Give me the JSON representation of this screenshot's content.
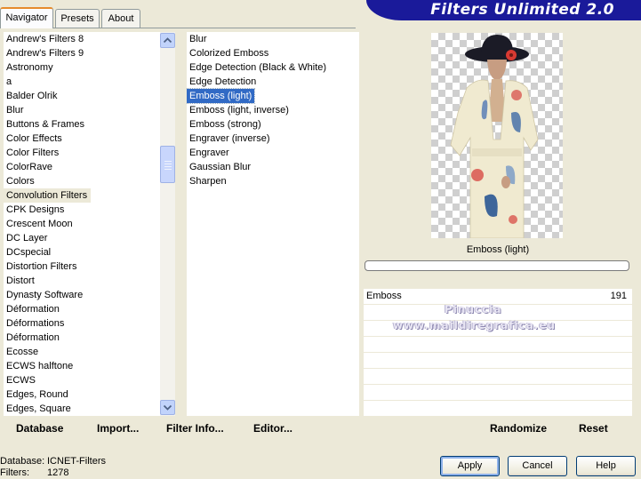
{
  "tabs": [
    {
      "label": "Navigator",
      "active": true
    },
    {
      "label": "Presets",
      "active": false
    },
    {
      "label": "About",
      "active": false
    }
  ],
  "app_title": "Filters Unlimited 2.0",
  "categories": [
    "Andrew's Filters 8",
    "Andrew's Filters 9",
    "Astronomy",
    "a",
    "Balder Olrik",
    "Blur",
    "Buttons & Frames",
    "Color Effects",
    "Color Filters",
    "ColorRave",
    "Colors",
    "Convolution Filters",
    "CPK Designs",
    "Crescent Moon",
    "DC Layer",
    "DCspecial",
    "Distortion Filters",
    "Distort",
    "Dynasty Software",
    "Déformation",
    "Déformations",
    "Déformation",
    "Ecosse",
    "ECWS halftone",
    "ECWS",
    "Edges, Round",
    "Edges, Square"
  ],
  "selected_category": "Convolution Filters",
  "filters": [
    "Blur",
    "Colorized Emboss",
    "Edge Detection (Black & White)",
    "Edge Detection",
    "Emboss (light)",
    "Emboss (light, inverse)",
    "Emboss (strong)",
    "Engraver (inverse)",
    "Engraver",
    "Gaussian Blur",
    "Sharpen"
  ],
  "selected_filter": "Emboss (light)",
  "preview": {
    "filter_name": "Emboss (light)"
  },
  "parameters": [
    {
      "name": "Emboss",
      "value": "191"
    }
  ],
  "watermark": {
    "line1": "Pinuccia",
    "line2": "www.maildiregrafica.eu"
  },
  "toolbar": {
    "database": "Database",
    "import": "Import...",
    "filter_info": "Filter Info...",
    "editor": "Editor...",
    "randomize": "Randomize",
    "reset": "Reset"
  },
  "status": {
    "database_label": "Database:",
    "database_value": "ICNET-Filters",
    "filters_label": "Filters:",
    "filters_value": "1278"
  },
  "buttons": {
    "apply": "Apply",
    "cancel": "Cancel",
    "help": "Help"
  },
  "colors": {
    "banner": "#1a1a9a",
    "selection_blue": "#316ac5",
    "selection_gray": "#ece9d8",
    "tab_accent": "#e68b2c"
  }
}
